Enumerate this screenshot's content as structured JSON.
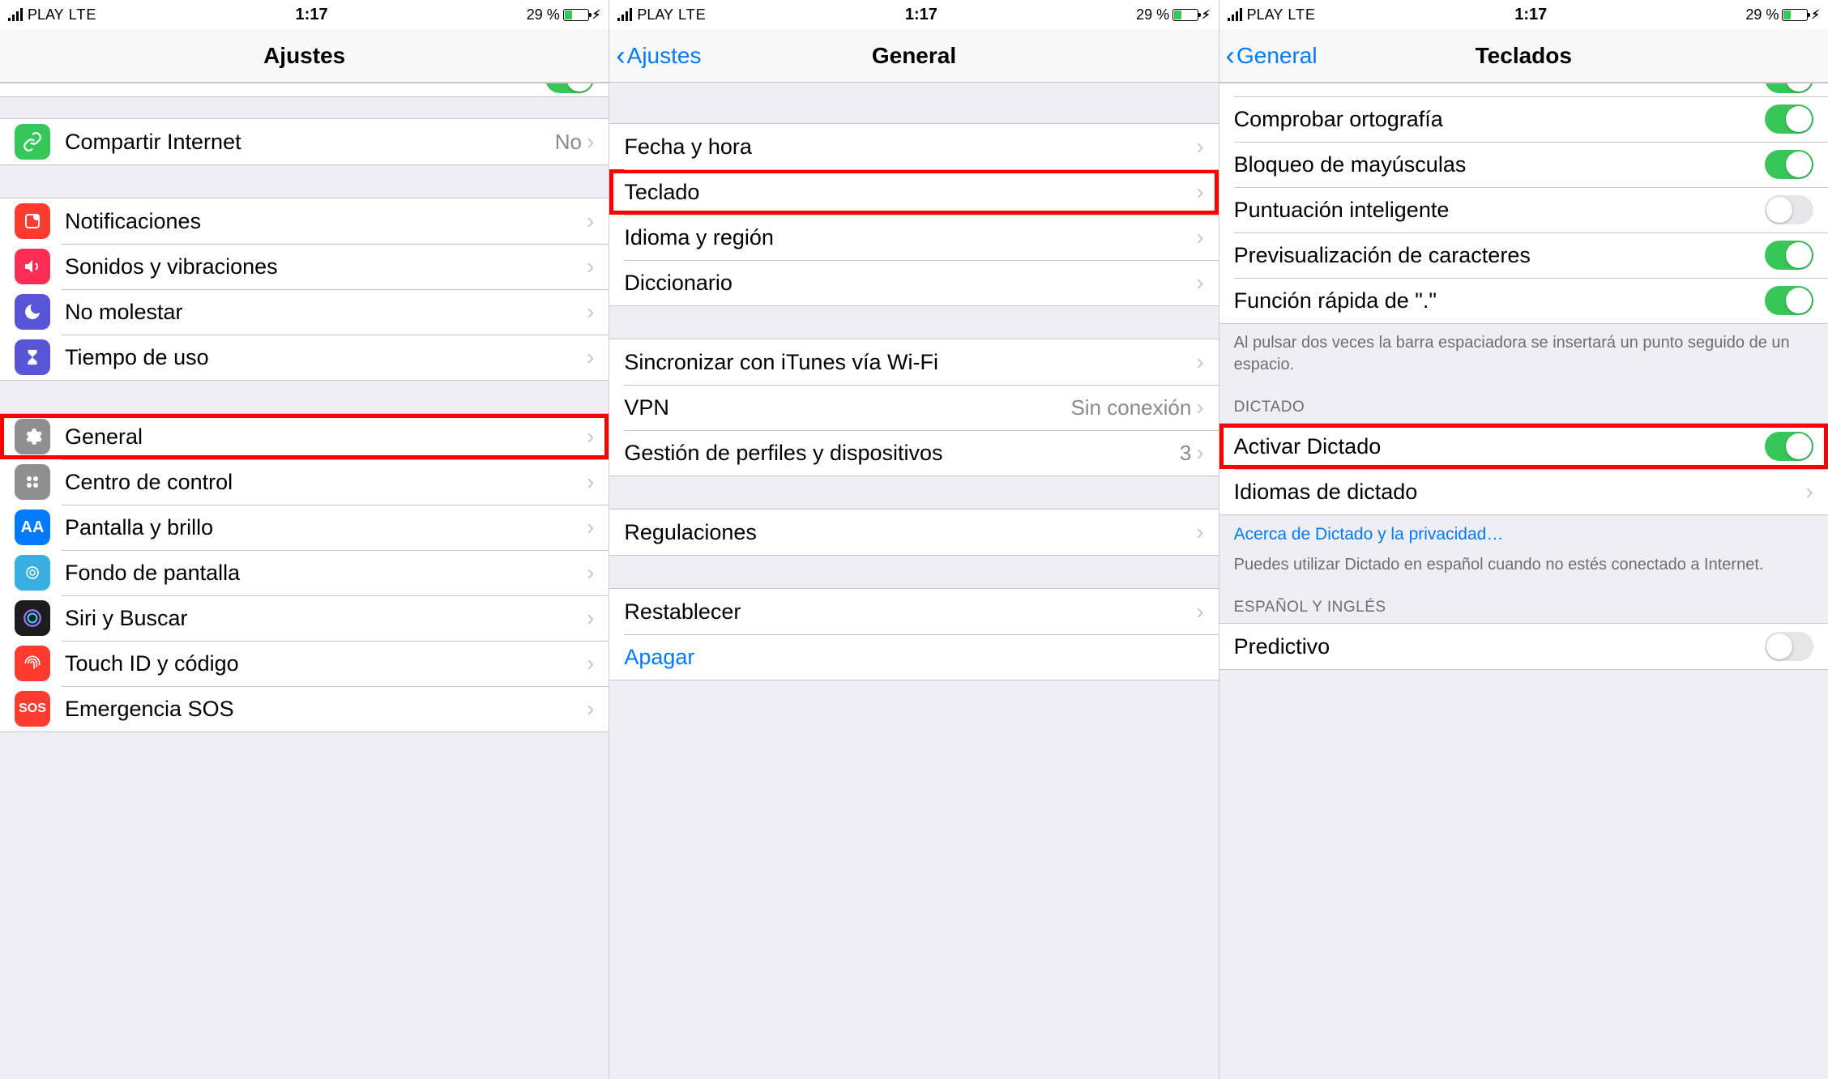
{
  "status": {
    "carrier": "PLAY",
    "network": "LTE",
    "time": "1:17",
    "battery_pct": "29 %"
  },
  "screen1": {
    "title": "Ajustes",
    "hotspot": {
      "label": "Compartir Internet",
      "value": "No"
    },
    "items_a": [
      {
        "label": "Notificaciones"
      },
      {
        "label": "Sonidos y vibraciones"
      },
      {
        "label": "No molestar"
      },
      {
        "label": "Tiempo de uso"
      }
    ],
    "items_b": [
      {
        "label": "General"
      },
      {
        "label": "Centro de control"
      },
      {
        "label": "Pantalla y brillo"
      },
      {
        "label": "Fondo de pantalla"
      },
      {
        "label": "Siri y Buscar"
      },
      {
        "label": "Touch ID y código"
      },
      {
        "label": "Emergencia SOS"
      }
    ]
  },
  "screen2": {
    "back": "Ajustes",
    "title": "General",
    "items_a": [
      {
        "label": "Fecha y hora"
      },
      {
        "label": "Teclado"
      },
      {
        "label": "Idioma y región"
      },
      {
        "label": "Diccionario"
      }
    ],
    "items_b": [
      {
        "label": "Sincronizar con iTunes vía Wi-Fi"
      },
      {
        "label": "VPN",
        "value": "Sin conexión"
      },
      {
        "label": "Gestión de perfiles y dispositivos",
        "value": "3"
      }
    ],
    "items_c": [
      {
        "label": "Regulaciones"
      }
    ],
    "items_d": [
      {
        "label": "Restablecer"
      },
      {
        "label": "Apagar",
        "link": true
      }
    ]
  },
  "screen3": {
    "back": "General",
    "title": "Teclados",
    "items_top": [
      {
        "label": "Comprobar ortografía",
        "on": true
      },
      {
        "label": "Bloqueo de mayúsculas",
        "on": true
      },
      {
        "label": "Puntuación inteligente",
        "on": false
      },
      {
        "label": "Previsualización de caracteres",
        "on": true
      },
      {
        "label": "Función rápida de \".\"",
        "on": true
      }
    ],
    "footer_top": "Al pulsar dos veces la barra espaciadora se insertará un punto seguido de un espacio.",
    "dictation_header": "DICTADO",
    "dictation": {
      "activate_label": "Activar Dictado",
      "activate_on": true,
      "langs_label": "Idiomas de dictado"
    },
    "privacy_link": "Acerca de Dictado y la privacidad…",
    "privacy_note": "Puedes utilizar Dictado en español cuando no estés conectado a Internet.",
    "lang_header": "ESPAÑOL Y INGLÉS",
    "predictive": {
      "label": "Predictivo",
      "on": false
    }
  }
}
